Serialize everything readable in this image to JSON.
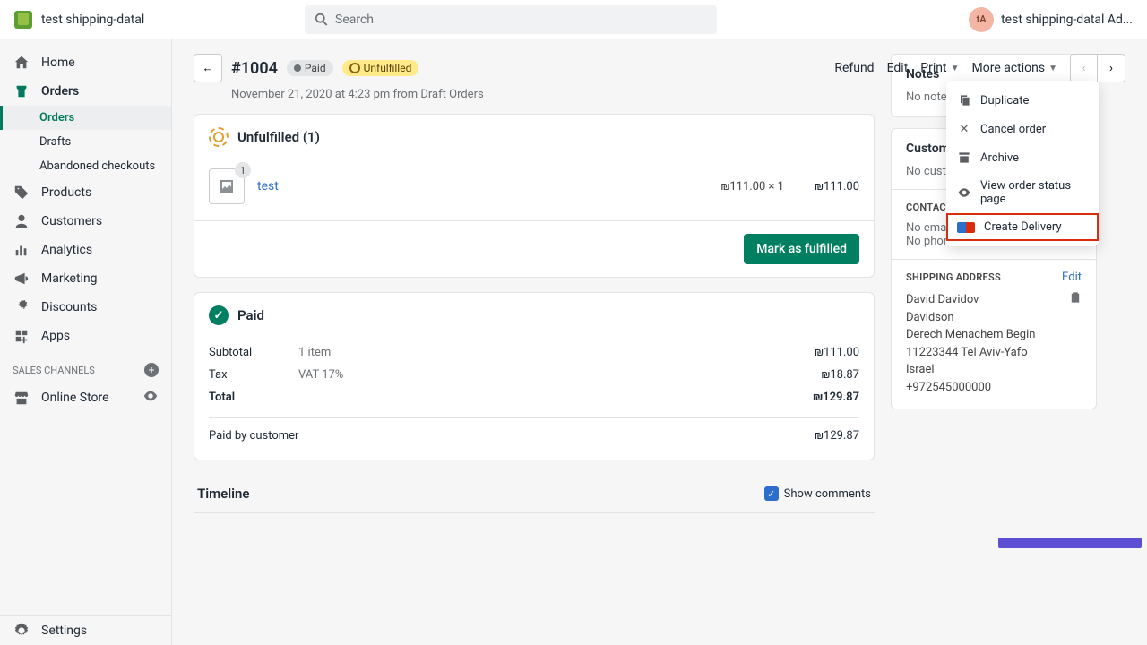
{
  "topbar": {
    "store_name": "test shipping-datal",
    "search_placeholder": "Search",
    "avatar_initials": "tA",
    "user_label": "test shipping-datal Ad..."
  },
  "sidebar": {
    "items": [
      {
        "label": "Home",
        "icon": "home"
      },
      {
        "label": "Orders",
        "icon": "orders",
        "selected": true
      },
      {
        "label": "Orders",
        "sub": true,
        "active": true
      },
      {
        "label": "Drafts",
        "sub": true
      },
      {
        "label": "Abandoned checkouts",
        "sub": true
      },
      {
        "label": "Products",
        "icon": "tag"
      },
      {
        "label": "Customers",
        "icon": "user"
      },
      {
        "label": "Analytics",
        "icon": "bars"
      },
      {
        "label": "Marketing",
        "icon": "horn"
      },
      {
        "label": "Discounts",
        "icon": "percent"
      },
      {
        "label": "Apps",
        "icon": "apps"
      }
    ],
    "section_label": "SALES CHANNELS",
    "online_store": "Online Store",
    "settings": "Settings"
  },
  "order": {
    "number": "#1004",
    "paid_badge": "Paid",
    "fulfillment_badge": "Unfulfilled",
    "subhead": "November 21, 2020 at 4:23 pm from Draft Orders"
  },
  "actions": {
    "refund": "Refund",
    "edit": "Edit",
    "print": "Print",
    "more": "More actions"
  },
  "dropdown": {
    "duplicate": "Duplicate",
    "cancel": "Cancel order",
    "archive": "Archive",
    "view_status": "View order status page",
    "create_delivery": "Create Delivery"
  },
  "fulfillment": {
    "header": "Unfulfilled (1)",
    "item_count_badge": "1",
    "item_name": "test",
    "item_price_qty": "₪111.00 × 1",
    "item_total": "₪111.00",
    "mark_button": "Mark as fulfilled"
  },
  "payment": {
    "header": "Paid",
    "subtotal_label": "Subtotal",
    "subtotal_meta": "1 item",
    "subtotal_amount": "₪111.00",
    "tax_label": "Tax",
    "tax_meta": "VAT 17%",
    "tax_amount": "₪18.87",
    "total_label": "Total",
    "total_amount": "₪129.87",
    "paid_label": "Paid by customer",
    "paid_amount": "₪129.87"
  },
  "timeline": {
    "header": "Timeline",
    "show_comments": "Show comments"
  },
  "notes": {
    "header": "Notes",
    "empty": "No notes f"
  },
  "customer": {
    "header": "Custome",
    "empty": "No customer",
    "contact_title": "CONTACT INFORMATION",
    "edit": "Edit",
    "no_email": "No email provided",
    "no_phone": "No phone number",
    "shipping_title": "SHIPPING ADDRESS",
    "addr1": "David Davidov",
    "addr2": "Davidson",
    "addr3": "Derech Menachem Begin",
    "addr4": "11223344 Tel Aviv-Yafo",
    "addr5": "Israel",
    "addr6": "+972545000000"
  }
}
